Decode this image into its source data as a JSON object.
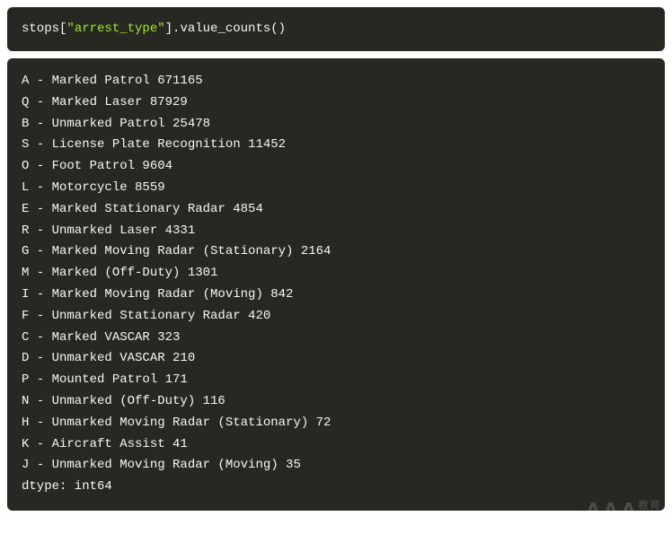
{
  "code": {
    "prefix": "stops[",
    "string": "\"arrest_type\"",
    "suffix": "].value_counts()"
  },
  "output": {
    "rows": [
      {
        "code": "A",
        "label": "Marked Patrol",
        "count": 671165
      },
      {
        "code": "Q",
        "label": "Marked Laser",
        "count": 87929
      },
      {
        "code": "B",
        "label": "Unmarked Patrol",
        "count": 25478
      },
      {
        "code": "S",
        "label": "License Plate Recognition",
        "count": 11452
      },
      {
        "code": "O",
        "label": "Foot Patrol",
        "count": 9604
      },
      {
        "code": "L",
        "label": "Motorcycle",
        "count": 8559
      },
      {
        "code": "E",
        "label": "Marked Stationary Radar",
        "count": 4854
      },
      {
        "code": "R",
        "label": "Unmarked Laser",
        "count": 4331
      },
      {
        "code": "G",
        "label": "Marked Moving Radar (Stationary)",
        "count": 2164
      },
      {
        "code": "M",
        "label": "Marked (Off-Duty)",
        "count": 1301
      },
      {
        "code": "I",
        "label": "Marked Moving Radar (Moving)",
        "count": 842
      },
      {
        "code": "F",
        "label": "Unmarked Stationary Radar",
        "count": 420
      },
      {
        "code": "C",
        "label": "Marked VASCAR",
        "count": 323
      },
      {
        "code": "D",
        "label": "Unmarked VASCAR",
        "count": 210
      },
      {
        "code": "P",
        "label": "Mounted Patrol",
        "count": 171
      },
      {
        "code": "N",
        "label": "Unmarked (Off-Duty)",
        "count": 116
      },
      {
        "code": "H",
        "label": "Unmarked Moving Radar (Stationary)",
        "count": 72
      },
      {
        "code": "K",
        "label": "Aircraft Assist",
        "count": 41
      },
      {
        "code": "J",
        "label": "Unmarked Moving Radar (Moving)",
        "count": 35
      }
    ],
    "dtype": "dtype: int64"
  },
  "watermark": {
    "text": "AAA",
    "suffix": "教育"
  }
}
